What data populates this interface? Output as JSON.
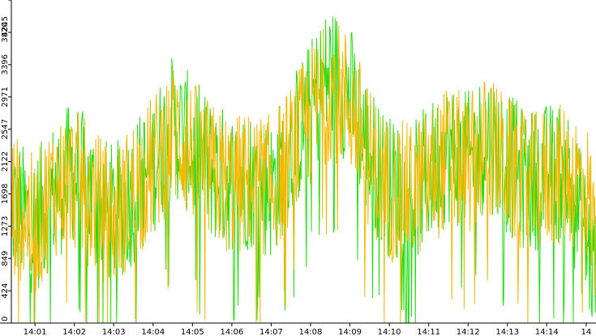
{
  "chart_data": {
    "type": "line",
    "title": "",
    "xlabel": "",
    "ylabel": "",
    "ylim": [
      0,
      4245
    ],
    "grid": false,
    "legend": "none",
    "x_tick_labels": [
      "14:01",
      "14:02",
      "14:03",
      "14:04",
      "14:05",
      "14:06",
      "14:07",
      "14:08",
      "14:09",
      "14:10",
      "14:11",
      "14:12",
      "14:13",
      "14:14",
      "14"
    ],
    "y_tick_labels": [
      "0",
      "424",
      "849",
      "1273",
      "1698",
      "2122",
      "2547",
      "2971",
      "3396",
      "3820",
      "4245"
    ],
    "x_range_minutes": [
      14.4,
      29.25
    ],
    "series": [
      {
        "color": "#22dd11",
        "x": [
          14.5,
          15.0,
          15.5,
          16.0,
          16.5,
          17.0,
          17.5,
          18.0,
          18.5,
          19.0,
          19.5,
          20.0,
          20.5,
          21.0,
          21.5,
          22.0,
          22.5,
          23.0,
          23.5,
          24.0,
          24.5,
          25.0,
          25.5,
          26.0,
          26.5,
          27.0,
          27.5,
          28.0,
          28.5,
          29.0,
          29.2
        ],
        "values": [
          1500,
          1300,
          1750,
          2000,
          1650,
          1400,
          1700,
          2100,
          2600,
          2300,
          2000,
          1850,
          1900,
          1750,
          2300,
          2800,
          3300,
          3000,
          2200,
          1800,
          1650,
          1950,
          2250,
          2100,
          2450,
          2100,
          1850,
          1950,
          2000,
          1100,
          650
        ]
      },
      {
        "color": "#f5b800",
        "x": [
          14.5,
          15.0,
          15.5,
          16.0,
          16.5,
          17.0,
          17.5,
          18.0,
          18.5,
          19.0,
          19.5,
          20.0,
          20.5,
          21.0,
          21.5,
          22.0,
          22.5,
          23.0,
          23.5,
          24.0,
          24.5,
          25.0,
          25.5,
          26.0,
          26.5,
          27.0,
          27.5,
          28.0,
          28.5,
          29.0,
          29.2
        ],
        "values": [
          1550,
          1250,
          1800,
          1900,
          1600,
          1350,
          1750,
          2050,
          2500,
          2250,
          1950,
          1800,
          1850,
          1800,
          2200,
          2700,
          3100,
          2900,
          2150,
          1750,
          1700,
          1900,
          2200,
          2050,
          2350,
          2050,
          1800,
          1900,
          1950,
          1800,
          1200
        ]
      }
    ]
  }
}
